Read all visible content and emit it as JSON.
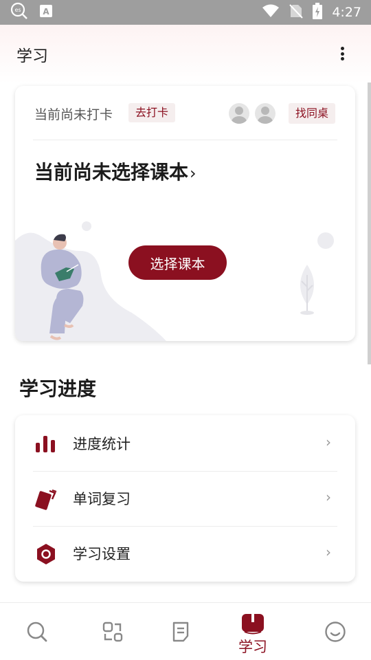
{
  "status_bar": {
    "time": "4:27",
    "left_icons": [
      "es-search-icon",
      "a-font-icon"
    ],
    "right_icons": [
      "wifi-icon",
      "no-sim-icon",
      "battery-charging-icon"
    ]
  },
  "header": {
    "title": "学习",
    "more_icon": "more-vertical-icon"
  },
  "checkin_card": {
    "status_text": "当前尚未打卡",
    "checkin_button": "去打卡",
    "find_deskmate_button": "找同桌",
    "textbook_title": "当前尚未选择课本",
    "textbook_chevron": "›",
    "select_textbook_button": "选择课本"
  },
  "progress_section": {
    "title": "学习进度",
    "items": [
      {
        "label": "进度统计",
        "icon": "bar-chart-icon",
        "arrow": "›"
      },
      {
        "label": "单词复习",
        "icon": "cards-icon",
        "arrow": "›"
      },
      {
        "label": "学习设置",
        "icon": "hexagon-settings-icon",
        "arrow": "›"
      }
    ]
  },
  "bottom_nav": {
    "items": [
      {
        "icon": "search-icon",
        "label": ""
      },
      {
        "icon": "scan-icon",
        "label": ""
      },
      {
        "icon": "notes-icon",
        "label": ""
      },
      {
        "icon": "book-icon",
        "label": "学习",
        "active": true
      },
      {
        "icon": "smile-icon",
        "label": ""
      }
    ]
  },
  "colors": {
    "accent": "#8b1020",
    "status_bar": "#9e9e9e",
    "chip_bg": "#f5eeee"
  }
}
